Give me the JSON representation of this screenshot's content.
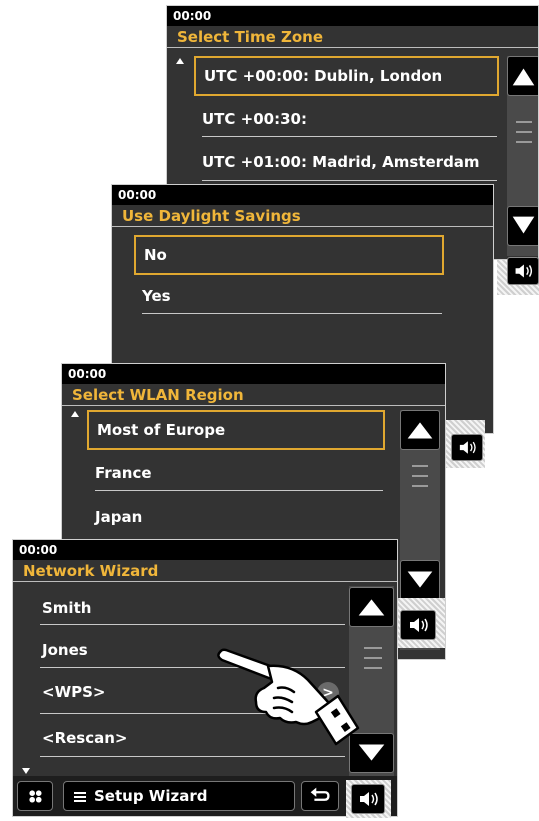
{
  "screens": {
    "timezone": {
      "clock": "00:00",
      "title": "Select Time Zone",
      "items": [
        "UTC +00:00: Dublin, London",
        "UTC +00:30:",
        "UTC +01:00: Madrid, Amsterdam"
      ]
    },
    "daylight": {
      "clock": "00:00",
      "title": "Use Daylight Savings",
      "items": [
        "No",
        "Yes"
      ]
    },
    "wlan": {
      "clock": "00:00",
      "title": "Select WLAN Region",
      "items": [
        "Most of Europe",
        "France",
        "Japan"
      ]
    },
    "network": {
      "clock": "00:00",
      "title": "Network Wizard",
      "items": [
        "Smith",
        "Jones",
        "<WPS>",
        "<Rescan>"
      ],
      "wps_arrow": ">",
      "footer": {
        "menu_label": "Setup Wizard"
      }
    }
  },
  "icons": {
    "scroll_up": "triangle-up-icon",
    "scroll_down": "triangle-down-icon",
    "volume": "speaker-icon",
    "home": "four-dots-icon",
    "back": "return-arrow-icon",
    "menu": "hamburger-icon",
    "pointer": "pointing-hand-icon"
  },
  "colors": {
    "accent": "#f0b63a",
    "selection_border": "#e0a830",
    "screen_bg": "#333333",
    "status_bg": "#000000"
  }
}
